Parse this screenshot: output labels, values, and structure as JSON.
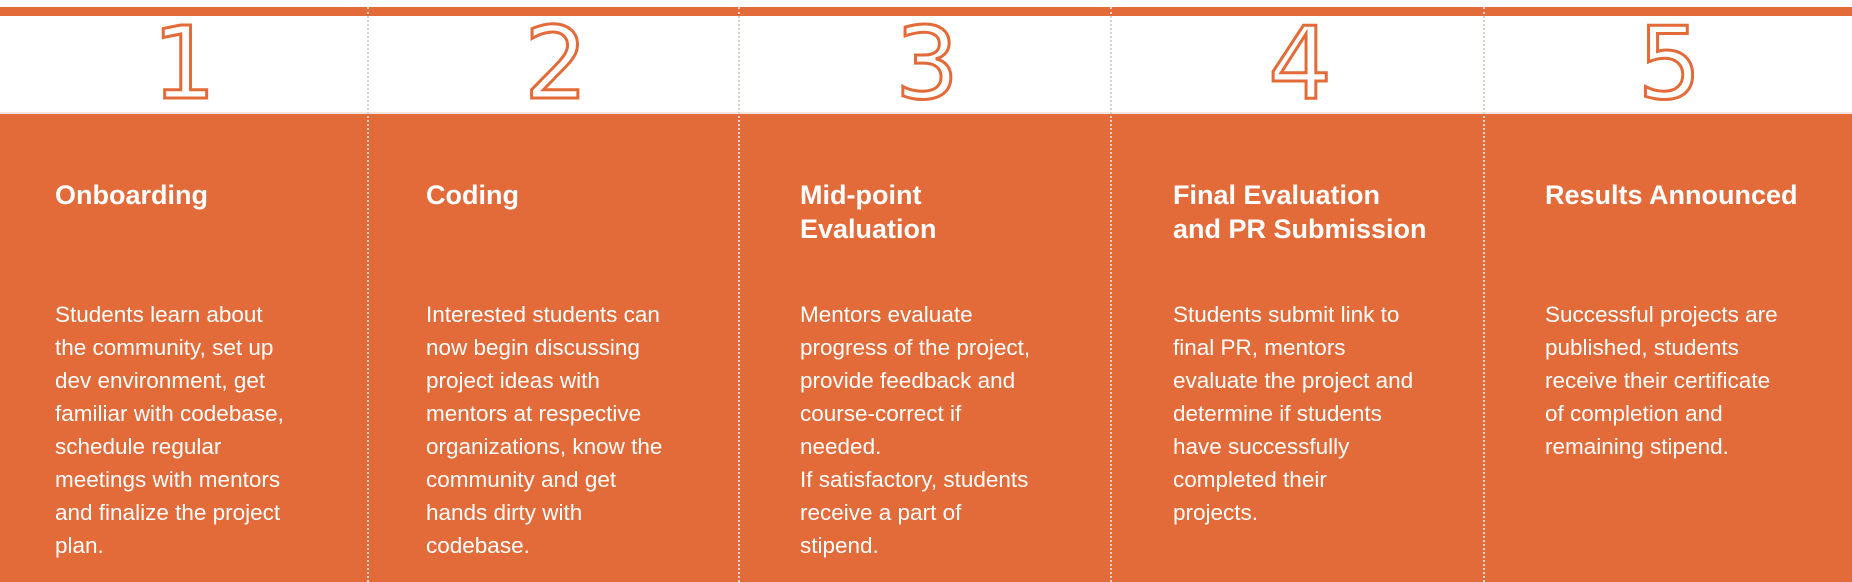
{
  "colors": {
    "accent": "#e36b3a",
    "panel": "#e36b3a",
    "background": "#ffffff",
    "text_on_panel": "#ffffff"
  },
  "steps": [
    {
      "number": "1",
      "title": "Onboarding",
      "description": "Students learn about\nthe community, set up\ndev environment, get\nfamiliar with codebase,\nschedule regular\nmeetings with mentors\nand finalize the project\nplan."
    },
    {
      "number": "2",
      "title": "Coding",
      "description": "Interested students can\nnow begin discussing\nproject ideas with\nmentors at respective\norganizations, know the\ncommunity and get\nhands dirty with\ncodebase."
    },
    {
      "number": "3",
      "title": "Mid-point\nEvaluation",
      "description": "Mentors evaluate\nprogress of the project,\nprovide feedback and\ncourse-correct if\nneeded.\nIf satisfactory, students\nreceive a part of\nstipend."
    },
    {
      "number": "4",
      "title": "Final Evaluation\nand PR Submission",
      "description": "Students submit link to\nfinal PR, mentors\nevaluate the project and\ndetermine if students\nhave successfully\ncompleted their\nprojects."
    },
    {
      "number": "5",
      "title": "Results Announced",
      "description": "Successful projects are\npublished, students\nreceive their certificate\nof completion and\nremaining stipend."
    }
  ]
}
